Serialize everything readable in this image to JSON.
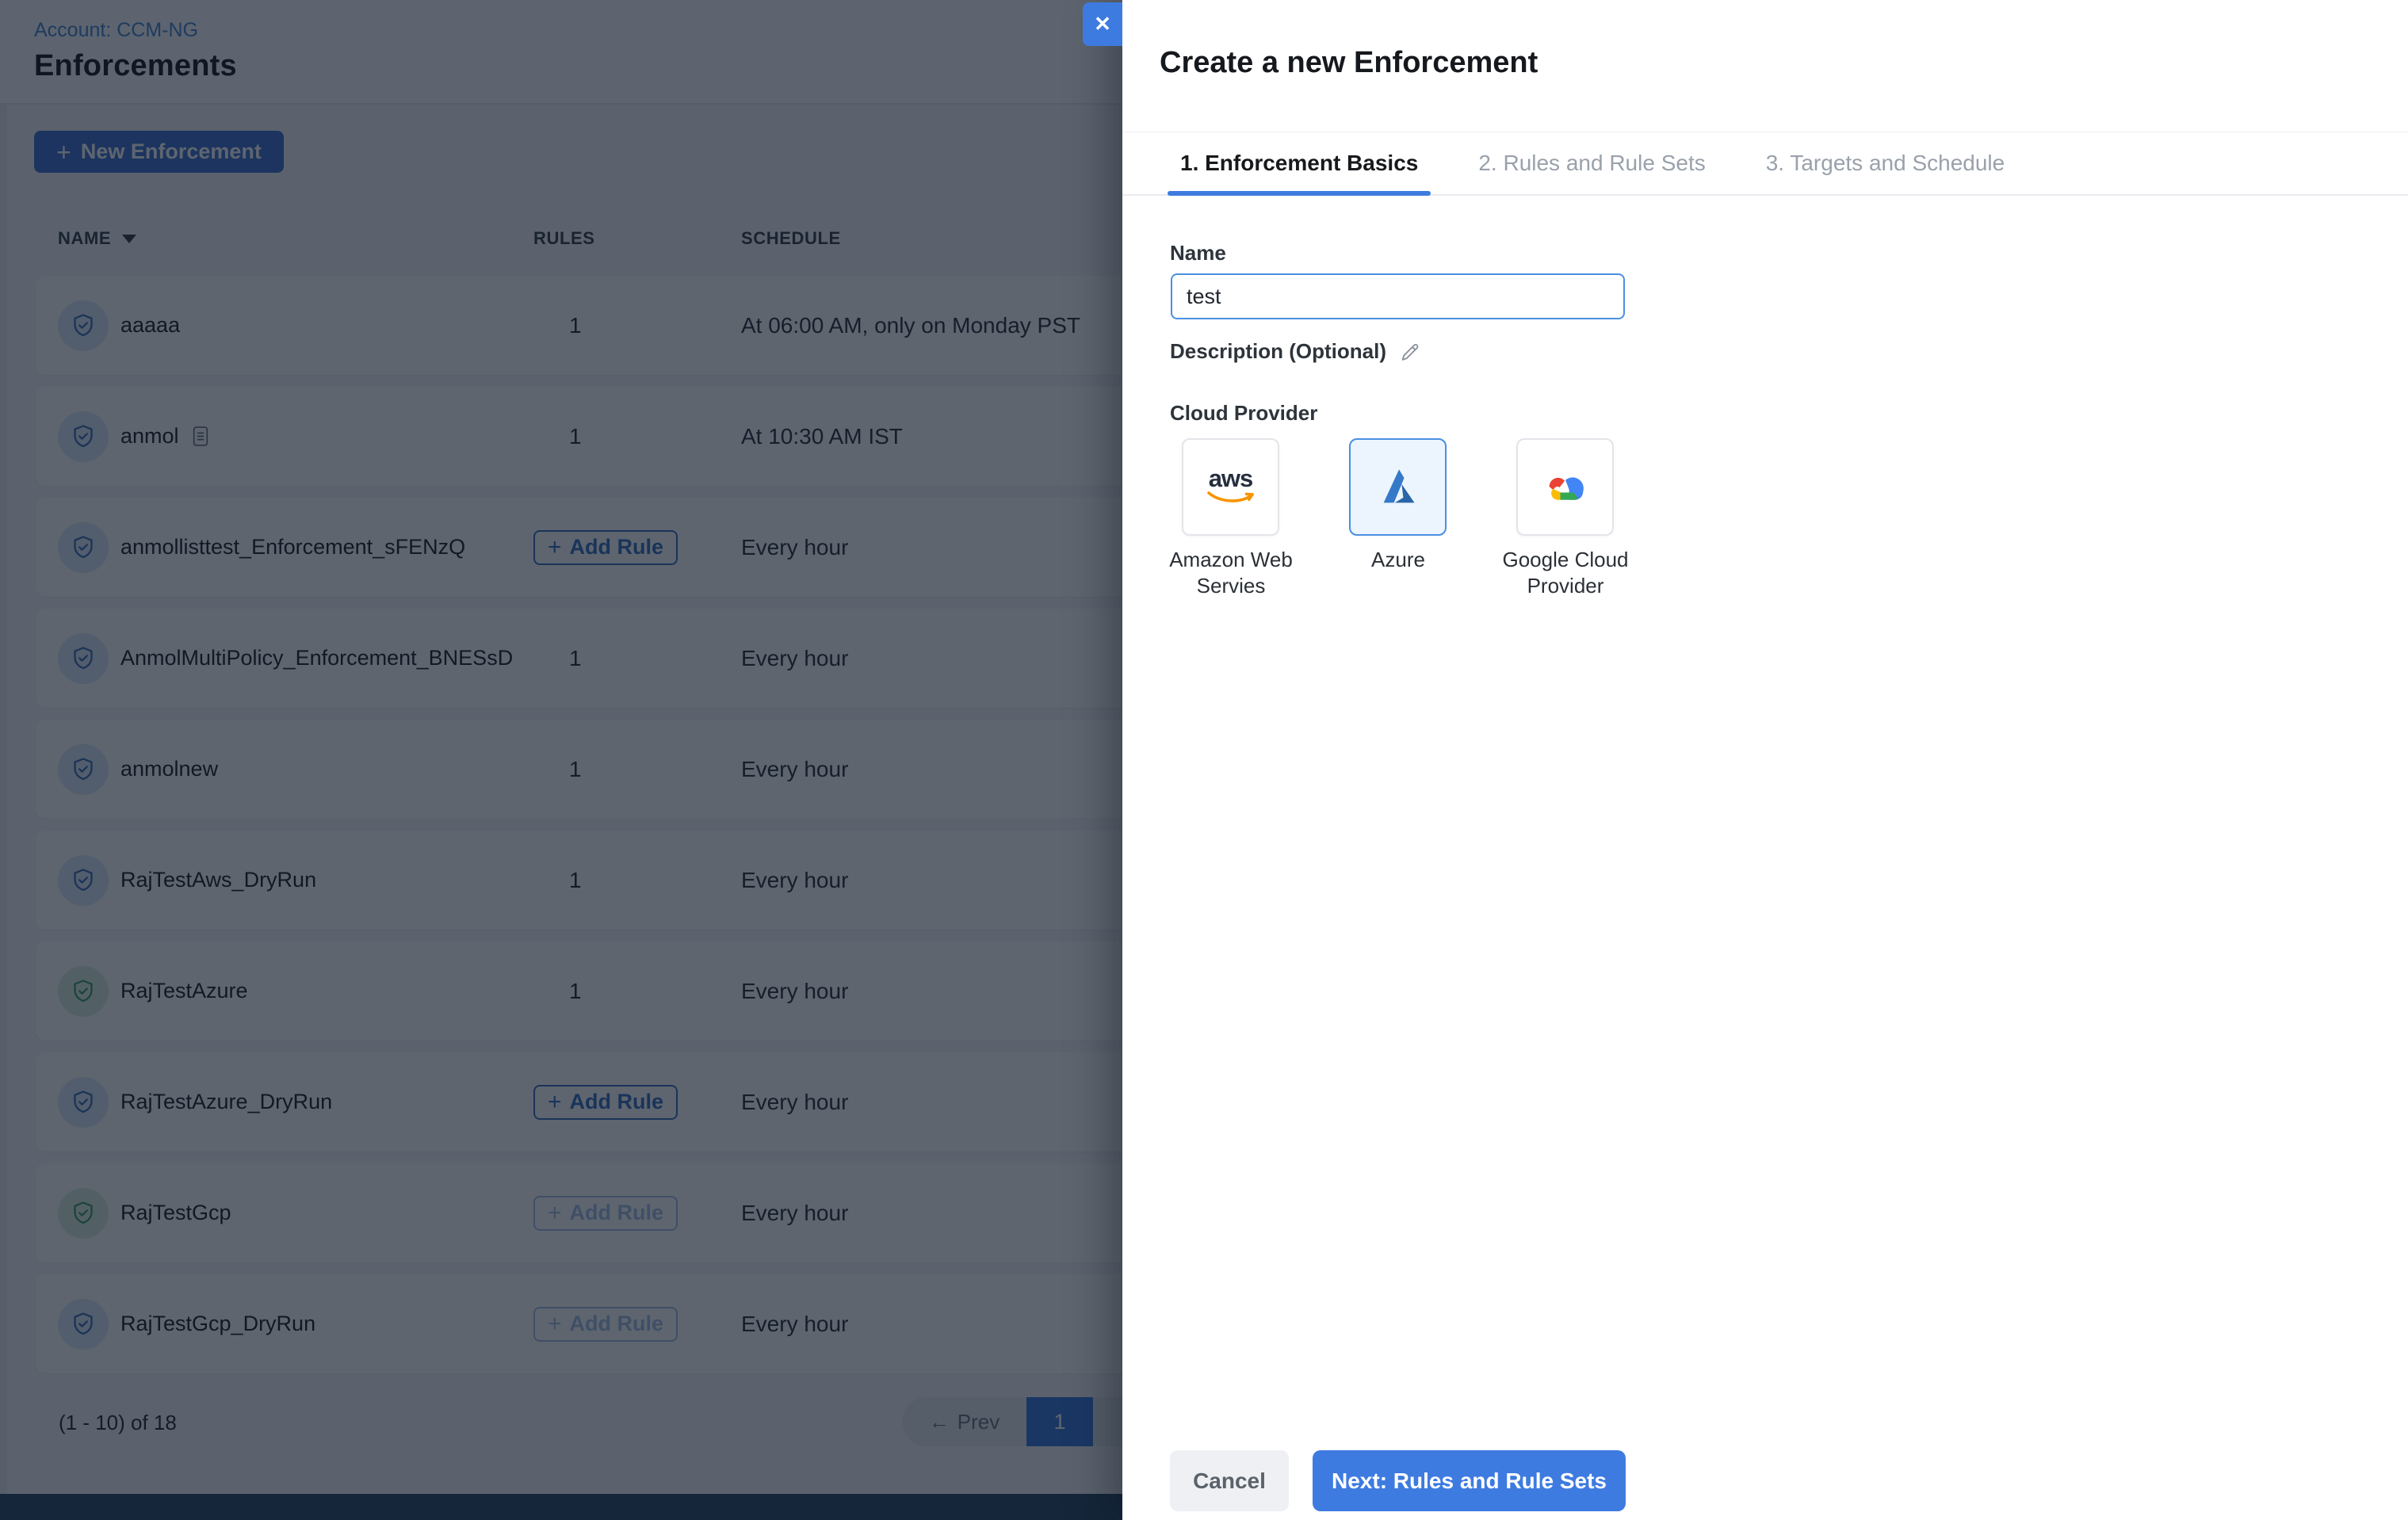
{
  "icons": {
    "plus": "+",
    "close": "✕",
    "prev_arrow": "←",
    "sort_caret": "▼"
  },
  "colors": {
    "accent_blue": "#3e7be0",
    "focus_border_blue": "#4a90e2",
    "shield_blue": "#3f6fb8",
    "shield_green": "#3fa068",
    "aws_orange": "#f79400",
    "aws_navy": "#252f3e",
    "google_blue": "#4285f4",
    "google_red": "#ea4335",
    "google_yellow": "#fbbc05",
    "google_green": "#34a853",
    "footer_bar": "#2e4a68"
  },
  "page": {
    "account_label": "Account: CCM-NG",
    "title": "Enforcements",
    "new_enforcement_label": "New Enforcement",
    "table": {
      "columns": [
        "NAME",
        "RULES",
        "SCHEDULE"
      ],
      "add_rule_label": "Add Rule",
      "rows": [
        {
          "name": "aaaaa",
          "icon": "shield-blue",
          "rules": "1",
          "schedule": "At 06:00 AM, only on Monday PST"
        },
        {
          "name": "anmol",
          "icon": "shield-blue",
          "rules": "1",
          "schedule": "At 10:30 AM IST"
        },
        {
          "name": "anmollisttest_Enforcement_sFENzQ",
          "icon": "shield-blue",
          "rules": "Add Rule",
          "schedule": "Every hour"
        },
        {
          "name": "AnmolMultiPolicy_Enforcement_BNESsD",
          "icon": "shield-blue",
          "rules": "1",
          "schedule": "Every hour"
        },
        {
          "name": "anmolnew",
          "icon": "shield-blue",
          "rules": "1",
          "schedule": "Every hour"
        },
        {
          "name": "RajTestAws_DryRun",
          "icon": "shield-blue",
          "rules": "1",
          "schedule": "Every hour"
        },
        {
          "name": "RajTestAzure",
          "icon": "shield-green",
          "rules": "1",
          "schedule": "Every hour"
        },
        {
          "name": "RajTestAzure_DryRun",
          "icon": "shield-blue",
          "rules": "Add Rule",
          "schedule": "Every hour"
        },
        {
          "name": "RajTestGcp",
          "icon": "shield-green",
          "rules": "Add Rule (disabled)",
          "schedule": "Every hour"
        },
        {
          "name": "RajTestGcp_DryRun",
          "icon": "shield-blue",
          "rules": "Add Rule (disabled)",
          "schedule": "Every hour"
        }
      ]
    },
    "pagination": {
      "range_text": "(1 - 10) of 18",
      "prev_label": "Prev",
      "current_page": "1"
    }
  },
  "modal": {
    "title": "Create a new Enforcement",
    "tabs": [
      {
        "label": "1. Enforcement Basics"
      },
      {
        "label": "2. Rules and Rule Sets"
      },
      {
        "label": "3. Targets and Schedule"
      }
    ],
    "name_label": "Name",
    "name_value": "test",
    "description_label": "Description (Optional)",
    "cloud_provider_label": "Cloud Provider",
    "providers": [
      {
        "label": "Amazon Web Servies",
        "selected": false
      },
      {
        "label": "Azure",
        "selected": true
      },
      {
        "label": "Google Cloud Provider",
        "selected": false
      }
    ],
    "aws_wordmark": "aws",
    "cancel_label": "Cancel",
    "next_label": "Next: Rules and Rule Sets"
  }
}
